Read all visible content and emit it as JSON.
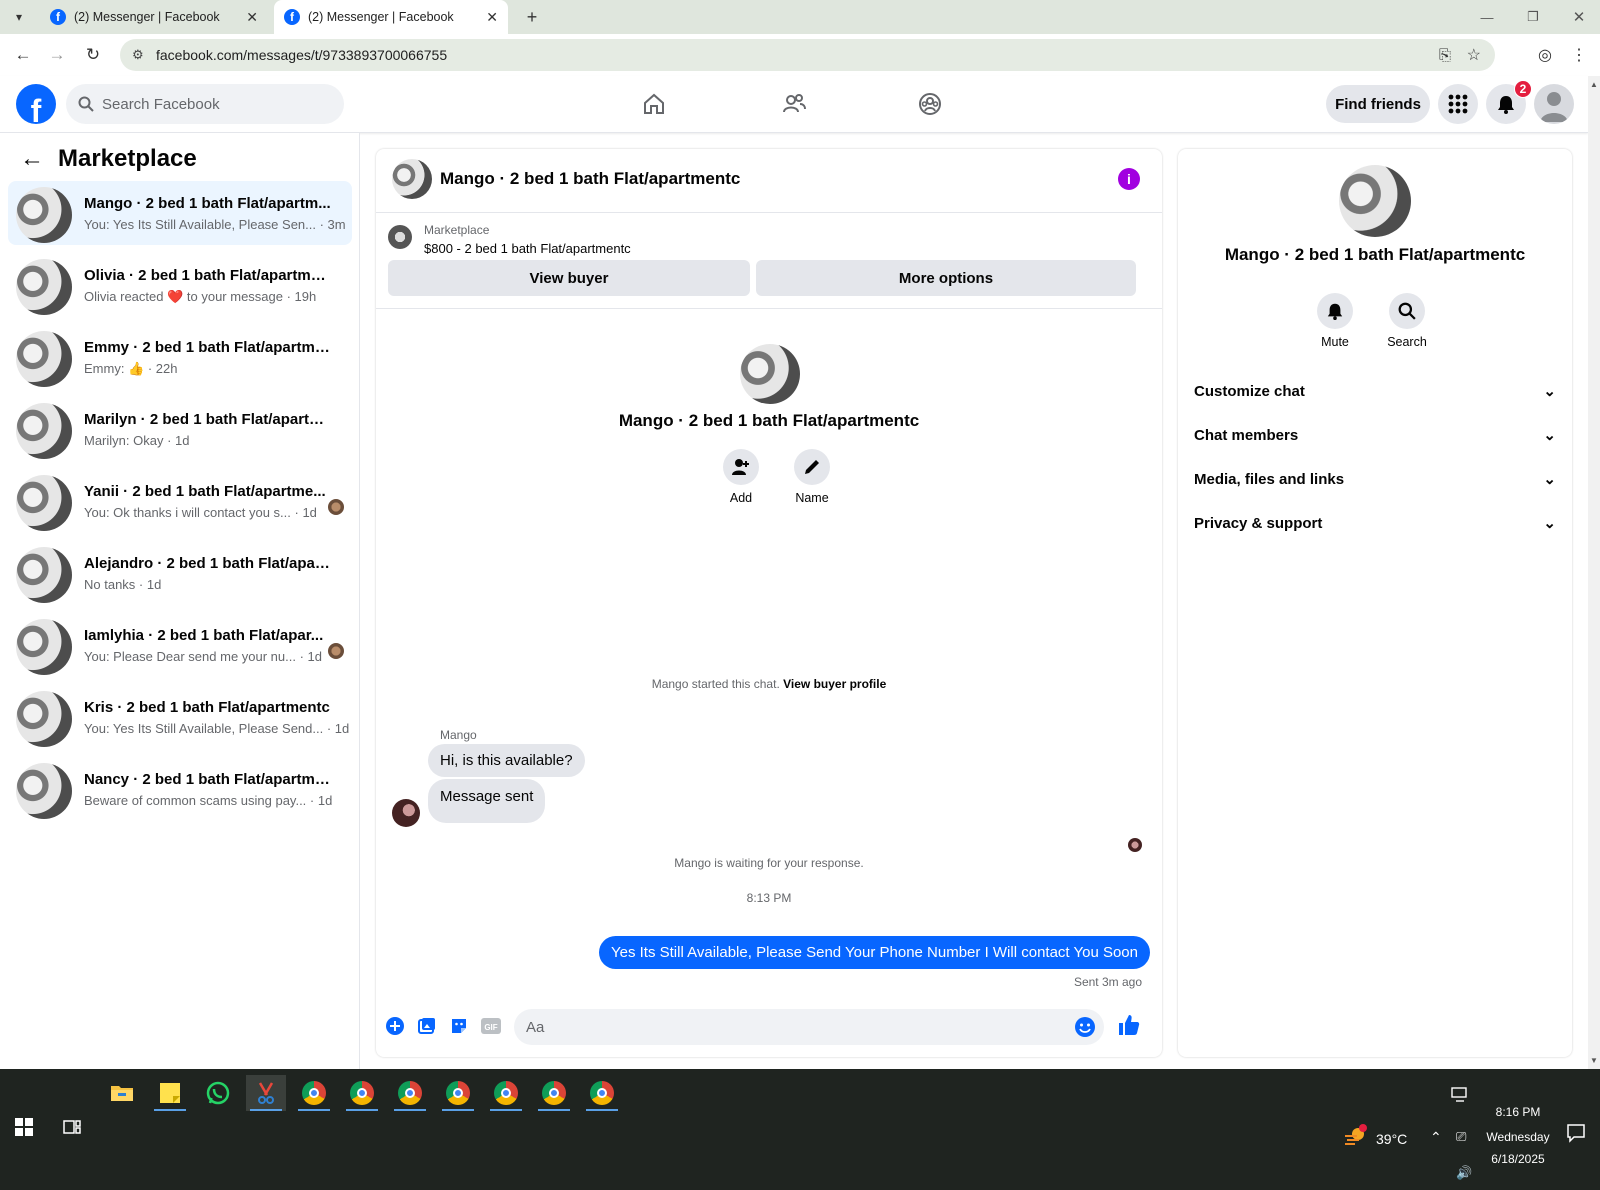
{
  "browser": {
    "tabs": [
      {
        "title": "(2) Messenger | Facebook"
      },
      {
        "title": "(2) Messenger | Facebook"
      }
    ],
    "url": "facebook.com/messages/t/9733893700066755"
  },
  "header": {
    "logo": "f",
    "search_placeholder": "Search Facebook",
    "find_friends": "Find friends",
    "notification_count": "2"
  },
  "sidebar": {
    "title": "Marketplace",
    "conversations": [
      {
        "name": "Mango · 2 bed 1 bath Flat/apartm...",
        "snippet": "You: Yes Its Still Available, Please Sen... · 3m"
      },
      {
        "name": "Olivia · 2 bed 1 bath Flat/apartmentc",
        "snippet": "Olivia reacted ❤️ to your message · 19h"
      },
      {
        "name": "Emmy · 2 bed 1 bath Flat/apartme...",
        "snippet": "Emmy: 👍 · 22h"
      },
      {
        "name": "Marilyn · 2 bed 1 bath Flat/apartm...",
        "snippet": "Marilyn: Okay · 1d"
      },
      {
        "name": "Yanii · 2 bed 1 bath Flat/apartme...",
        "snippet": "You: Ok thanks i will contact you s... · 1d"
      },
      {
        "name": "Alejandro · 2 bed 1 bath Flat/apart...",
        "snippet": "No tanks · 1d"
      },
      {
        "name": "Iamlyhia · 2 bed 1 bath Flat/apar...",
        "snippet": "You: Please Dear send me your nu... · 1d"
      },
      {
        "name": "Kris · 2 bed 1 bath Flat/apartmentc",
        "snippet": "You: Yes Its Still Available, Please Send... · 1d"
      },
      {
        "name": "Nancy · 2 bed 1 bath Flat/apartme...",
        "snippet": "Beware of common scams using pay... · 1d"
      }
    ]
  },
  "chat": {
    "title": "Mango · 2 bed 1 bath Flat/apartmentc",
    "marketplace_label": "Marketplace",
    "listing": "$800 - 2 bed 1 bath Flat/apartmentc",
    "view_buyer": "View buyer",
    "more_options": "More options",
    "center_name": "Mango · 2 bed 1 bath Flat/apartmentc",
    "add_label": "Add",
    "name_label": "Name",
    "started_text": "Mango started this chat.",
    "view_buyer_profile": "View buyer profile",
    "sender": "Mango",
    "msg1": "Hi, is this available?",
    "msg2": "Message sent",
    "waiting": "Mango is waiting for your response.",
    "time": "8:13 PM",
    "outgoing": "Yes Its Still Available, Please Send Your Phone Number I Will contact You Soon",
    "sent_status": "Sent 3m ago",
    "input_placeholder": "Aa"
  },
  "details": {
    "title": "Mango · 2 bed 1 bath Flat/apartmentc",
    "mute": "Mute",
    "search": "Search",
    "sections": [
      "Customize chat",
      "Chat members",
      "Media, files and links",
      "Privacy & support"
    ]
  },
  "taskbar": {
    "temperature": "39°C",
    "time": "8:16 PM",
    "day": "Wednesday",
    "date": "6/18/2025"
  },
  "colors": {
    "brand": "#0866ff",
    "info": "#a100e0",
    "badge": "#e41e3f"
  }
}
